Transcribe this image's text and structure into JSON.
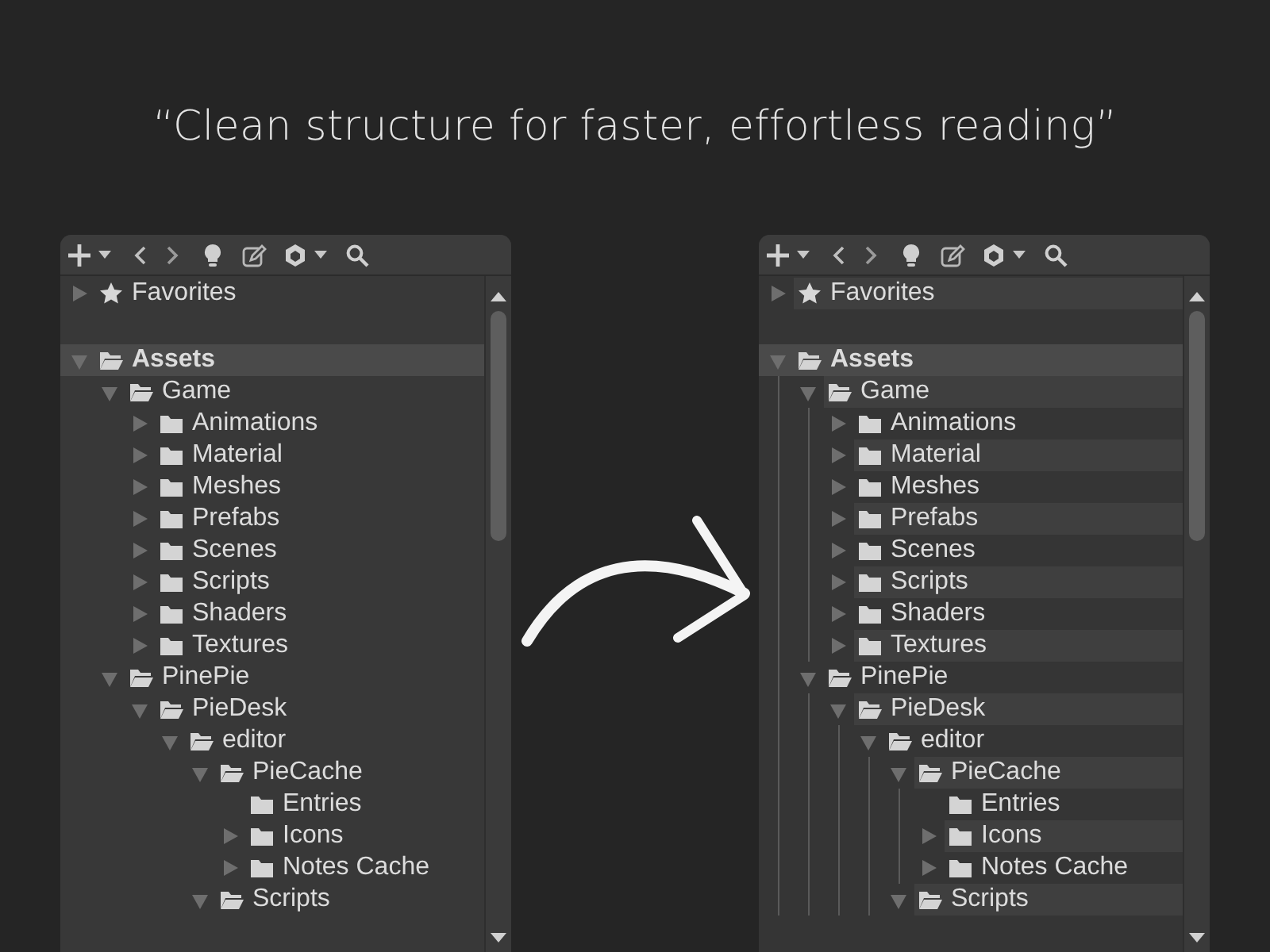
{
  "headline": "“Clean structure for faster, effortless reading”",
  "panels": [
    {
      "kind": "plain",
      "favorites": {
        "label": "Favorites",
        "expanded": false
      },
      "tree": [
        {
          "label": "Assets",
          "kind": "branch",
          "expanded": true,
          "selected": true,
          "children": [
            {
              "label": "Game",
              "kind": "branch",
              "expanded": true,
              "selected": false,
              "children": [
                {
                  "label": "Animations",
                  "kind": "branch",
                  "expanded": false,
                  "selected": false
                },
                {
                  "label": "Material",
                  "kind": "branch",
                  "expanded": false,
                  "selected": false
                },
                {
                  "label": "Meshes",
                  "kind": "branch",
                  "expanded": false,
                  "selected": false
                },
                {
                  "label": "Prefabs",
                  "kind": "branch",
                  "expanded": false,
                  "selected": false
                },
                {
                  "label": "Scenes",
                  "kind": "branch",
                  "expanded": false,
                  "selected": false
                },
                {
                  "label": "Scripts",
                  "kind": "branch",
                  "expanded": false,
                  "selected": false
                },
                {
                  "label": "Shaders",
                  "kind": "branch",
                  "expanded": false,
                  "selected": false
                },
                {
                  "label": "Textures",
                  "kind": "branch",
                  "expanded": false,
                  "selected": false
                }
              ]
            },
            {
              "label": "PinePie",
              "kind": "branch",
              "expanded": true,
              "selected": false,
              "children": [
                {
                  "label": "PieDesk",
                  "kind": "branch",
                  "expanded": true,
                  "selected": false,
                  "children": [
                    {
                      "label": "editor",
                      "kind": "branch",
                      "expanded": true,
                      "selected": false,
                      "children": [
                        {
                          "label": "PieCache",
                          "kind": "branch",
                          "expanded": true,
                          "selected": false,
                          "children": [
                            {
                              "label": "Entries",
                              "kind": "leaf",
                              "selected": false
                            },
                            {
                              "label": "Icons",
                              "kind": "branch",
                              "expanded": false,
                              "selected": false
                            },
                            {
                              "label": "Notes Cache",
                              "kind": "branch",
                              "expanded": false,
                              "selected": false
                            }
                          ]
                        },
                        {
                          "label": "Scripts",
                          "kind": "branch",
                          "expanded": true,
                          "selected": false
                        }
                      ]
                    }
                  ]
                }
              ]
            }
          ]
        }
      ]
    },
    {
      "kind": "striped",
      "favorites": {
        "label": "Favorites",
        "expanded": false
      },
      "tree": [
        {
          "label": "Assets",
          "kind": "branch",
          "expanded": true,
          "selected": true,
          "children": [
            {
              "label": "Game",
              "kind": "branch",
              "expanded": true,
              "selected": false,
              "children": [
                {
                  "label": "Animations",
                  "kind": "branch",
                  "expanded": false,
                  "selected": false
                },
                {
                  "label": "Material",
                  "kind": "branch",
                  "expanded": false,
                  "selected": false
                },
                {
                  "label": "Meshes",
                  "kind": "branch",
                  "expanded": false,
                  "selected": false
                },
                {
                  "label": "Prefabs",
                  "kind": "branch",
                  "expanded": false,
                  "selected": false
                },
                {
                  "label": "Scenes",
                  "kind": "branch",
                  "expanded": false,
                  "selected": false
                },
                {
                  "label": "Scripts",
                  "kind": "branch",
                  "expanded": false,
                  "selected": false
                },
                {
                  "label": "Shaders",
                  "kind": "branch",
                  "expanded": false,
                  "selected": false
                },
                {
                  "label": "Textures",
                  "kind": "branch",
                  "expanded": false,
                  "selected": false
                }
              ]
            },
            {
              "label": "PinePie",
              "kind": "branch",
              "expanded": true,
              "selected": false,
              "children": [
                {
                  "label": "PieDesk",
                  "kind": "branch",
                  "expanded": true,
                  "selected": false,
                  "children": [
                    {
                      "label": "editor",
                      "kind": "branch",
                      "expanded": true,
                      "selected": false,
                      "children": [
                        {
                          "label": "PieCache",
                          "kind": "branch",
                          "expanded": true,
                          "selected": false,
                          "children": [
                            {
                              "label": "Entries",
                              "kind": "leaf",
                              "selected": false
                            },
                            {
                              "label": "Icons",
                              "kind": "branch",
                              "expanded": false,
                              "selected": false
                            },
                            {
                              "label": "Notes Cache",
                              "kind": "branch",
                              "expanded": false,
                              "selected": false
                            }
                          ]
                        },
                        {
                          "label": "Scripts",
                          "kind": "branch",
                          "expanded": true,
                          "selected": false
                        }
                      ]
                    }
                  ]
                }
              ]
            }
          ]
        }
      ]
    }
  ]
}
